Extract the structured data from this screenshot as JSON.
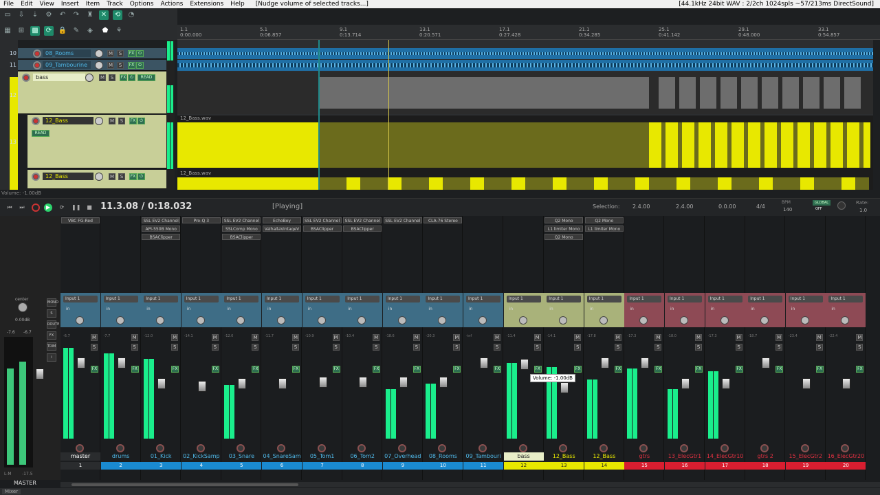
{
  "menu": {
    "items": [
      "File",
      "Edit",
      "View",
      "Insert",
      "Item",
      "Track",
      "Options",
      "Actions",
      "Extensions",
      "Help"
    ],
    "status": "[Nudge volume of selected tracks...]",
    "right": "[44.1kHz 24bit WAV : 2/2ch 1024spls ~57/213ms DirectSound]"
  },
  "ruler": {
    "marks": [
      {
        "bar": "1.1",
        "time": "0:00.000"
      },
      {
        "bar": "5.1",
        "time": "0:06.857"
      },
      {
        "bar": "9.1",
        "time": "0:13.714"
      },
      {
        "bar": "13.1",
        "time": "0:20.571"
      },
      {
        "bar": "17.1",
        "time": "0:27.428"
      },
      {
        "bar": "21.1",
        "time": "0:34.285"
      },
      {
        "bar": "25.1",
        "time": "0:41.142"
      },
      {
        "bar": "29.1",
        "time": "0:48.000"
      },
      {
        "bar": "33.1",
        "time": "0:54.857"
      }
    ]
  },
  "tracks": [
    {
      "num": "10",
      "name": "08_Rooms"
    },
    {
      "num": "11",
      "name": "09_Tambourine"
    },
    {
      "num": "12",
      "name": "bass",
      "auto": "READ"
    },
    {
      "num": "13",
      "name": "12_Bass",
      "auto": "READ"
    },
    {
      "num": "",
      "name": "12_Bass"
    }
  ],
  "items": {
    "bass_wav": "12_Bass.wav"
  },
  "volume_status": "Volume: -1.00dB",
  "transport": {
    "position": "11.3.08 / 0:18.032",
    "state": "[Playing]",
    "selection_label": "Selection:",
    "sel_start": "2.4.00",
    "sel_end": "2.4.00",
    "sel_len": "0.0.00",
    "timesig": "4/4",
    "bpm_label": "BPM",
    "bpm": "140",
    "global": "GLOBAL",
    "global_state": "OFF",
    "rate_label": "Rate:",
    "rate": "1.0"
  },
  "master": {
    "label": "center",
    "db": "0.00dB",
    "peakL": "-7.6",
    "peakR": "-6.7",
    "name": "MASTER",
    "lm": "L-M",
    "lmval": "-17.5",
    "side_buttons": [
      "MONO",
      "S",
      "ROUTE",
      "FX",
      "TRIM",
      "i"
    ]
  },
  "strips": [
    {
      "name": "master",
      "num": "1",
      "fx": [
        "VBC FG-Red"
      ],
      "vol": "-6.7",
      "color": "#3e6d86",
      "tc": "#ffffff",
      "nb": "#2a2c2e"
    },
    {
      "name": "drums",
      "num": "2",
      "fx": [],
      "vol": "-7.7",
      "color": "#3e6d86",
      "tc": "#4fb8e8",
      "nb": "#1a8ad0"
    },
    {
      "name": "01_Kick",
      "num": "3",
      "fx": [
        "SSL EV2 Channel",
        "API-550B Mono",
        "BSAClipper"
      ],
      "vol": "-12.0",
      "color": "#3e6d86",
      "tc": "#4fb8e8",
      "nb": "#1a8ad0"
    },
    {
      "name": "02_KickSamp",
      "num": "4",
      "fx": [
        "Pro-Q 3"
      ],
      "vol": "-14.1",
      "color": "#3e6d86",
      "tc": "#4fb8e8",
      "nb": "#1a8ad0"
    },
    {
      "name": "03_Snare",
      "num": "5",
      "fx": [
        "SSL EV2 Channel",
        "SSLComp Mono",
        "BSAClipper"
      ],
      "vol": "-12.0",
      "color": "#3e6d86",
      "tc": "#4fb8e8",
      "nb": "#1a8ad0"
    },
    {
      "name": "04_SnareSam",
      "num": "6",
      "fx": [
        "EchoBoy",
        "ValhallaVintageV"
      ],
      "vol": "-11.7",
      "color": "#3e6d86",
      "tc": "#4fb8e8",
      "nb": "#1a8ad0"
    },
    {
      "name": "05_Tom1",
      "num": "7",
      "fx": [
        "SSL EV2 Channel",
        "BSAClipper"
      ],
      "vol": "-10.9",
      "color": "#3e6d86",
      "tc": "#4fb8e8",
      "nb": "#1a8ad0"
    },
    {
      "name": "06_Tom2",
      "num": "8",
      "fx": [
        "SSL EV2 Channel",
        "BSAClipper"
      ],
      "vol": "-10.4",
      "color": "#3e6d86",
      "tc": "#4fb8e8",
      "nb": "#1a8ad0"
    },
    {
      "name": "07_Overhead",
      "num": "9",
      "fx": [
        "SSL EV2 Channel"
      ],
      "vol": "-18.6",
      "color": "#3e6d86",
      "tc": "#4fb8e8",
      "nb": "#1a8ad0"
    },
    {
      "name": "08_Rooms",
      "num": "10",
      "fx": [
        "CLA-76 Stereo"
      ],
      "vol": "-20.3",
      "color": "#3e6d86",
      "tc": "#4fb8e8",
      "nb": "#1a8ad0"
    },
    {
      "name": "09_Tambouri",
      "num": "11",
      "fx": [],
      "vol": "-inf",
      "color": "#3e6d86",
      "tc": "#4fb8e8",
      "nb": "#1a8ad0"
    },
    {
      "name": "bass",
      "num": "12",
      "fx": [],
      "vol": "-11.4",
      "color": "#a9b27a",
      "tc": "#222222",
      "nb": "#e8e800"
    },
    {
      "name": "12_Bass",
      "num": "13",
      "fx": [
        "Q2 Mono",
        "L1 limiter Mono",
        "Q2 Mono"
      ],
      "vol": "-14.1",
      "color": "#a9b27a",
      "tc": "#e8e800",
      "nb": "#e8e800"
    },
    {
      "name": "12_Bass",
      "num": "14",
      "fx": [
        "Q2 Mono",
        "L1 limiter Mono"
      ],
      "vol": "-17.8",
      "color": "#a9b27a",
      "tc": "#e8e800",
      "nb": "#e8e800"
    },
    {
      "name": "gtrs",
      "num": "15",
      "fx": [],
      "vol": "-17.3",
      "color": "#8e4a55",
      "tc": "#e03040",
      "nb": "#d81e30"
    },
    {
      "name": "13_ElecGtr1",
      "num": "16",
      "fx": [],
      "vol": "-18.0",
      "color": "#8e4a55",
      "tc": "#e03040",
      "nb": "#d81e30"
    },
    {
      "name": "14_ElecGtr10",
      "num": "17",
      "fx": [],
      "vol": "-17.3",
      "color": "#8e4a55",
      "tc": "#e03040",
      "nb": "#d81e30"
    },
    {
      "name": "gtrs 2",
      "num": "18",
      "fx": [],
      "vol": "-18.7",
      "color": "#8e4a55",
      "tc": "#e03040",
      "nb": "#d81e30"
    },
    {
      "name": "15_ElecGtr2",
      "num": "19",
      "fx": [],
      "vol": "-23.4",
      "color": "#8e4a55",
      "tc": "#e03040",
      "nb": "#d81e30"
    },
    {
      "name": "16_ElecGtr20",
      "num": "20",
      "fx": [],
      "vol": "-22.4",
      "color": "#8e4a55",
      "tc": "#e03040",
      "nb": "#d81e30"
    }
  ],
  "input_label": "Input 1",
  "in_label": "in",
  "mixer_tab": "Mixer",
  "strip_buttons": {
    "m": "M",
    "s": "S",
    "fx": "FX"
  },
  "tooltip": "Volume: -1.00dB"
}
